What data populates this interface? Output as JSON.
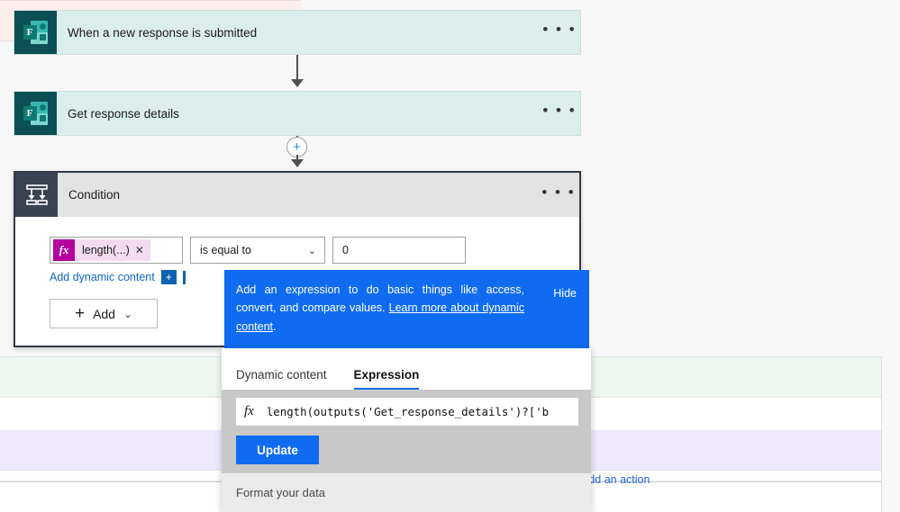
{
  "flow": {
    "trigger_card": {
      "title": "When a new response is submitted",
      "icon": "microsoft-forms-icon",
      "icon_letter": "F",
      "overflow_label": "• • •"
    },
    "action_card": {
      "title": "Get response details",
      "icon": "microsoft-forms-icon",
      "icon_letter": "F",
      "overflow_label": "• • •"
    },
    "insert_button_label": "+",
    "condition_card": {
      "title": "Condition",
      "overflow_label": "• • •",
      "expression_token": "length(...)",
      "token_remove_label": "✕",
      "fx_label": "fx",
      "operator_value": "is equal to",
      "operator_chevron": "⌄",
      "compare_value": "0",
      "add_dynamic_content_label": "Add dynamic content",
      "dynamic_plus_label": "+",
      "add_button_label": "Add",
      "add_button_plus": "+",
      "add_button_chevron": "⌄"
    }
  },
  "coach_tooltip": {
    "text_line1": "Add an expression to do basic things like access,",
    "text_line2": "convert, and compare values. ",
    "link_text": "Learn more about dynamic content",
    "trailing_period": ".",
    "hide_label": "Hide",
    "background_color": "#0f6cf0"
  },
  "expression_flyout": {
    "tabs": [
      {
        "label": "Dynamic content",
        "active": false
      },
      {
        "label": "Expression",
        "active": true
      }
    ],
    "fx_label": "fx",
    "expression_value": "length(outputs('Get_response_details')?['b",
    "update_button_label": "Update",
    "footer_label": "Format your data"
  },
  "background": {
    "add_action_link": "Add an action",
    "accent_color": "#0f6cf0",
    "card_fill": "#dbeeec",
    "icon_fill": "#0b4f54",
    "fx_badge_color": "#b4009e"
  }
}
